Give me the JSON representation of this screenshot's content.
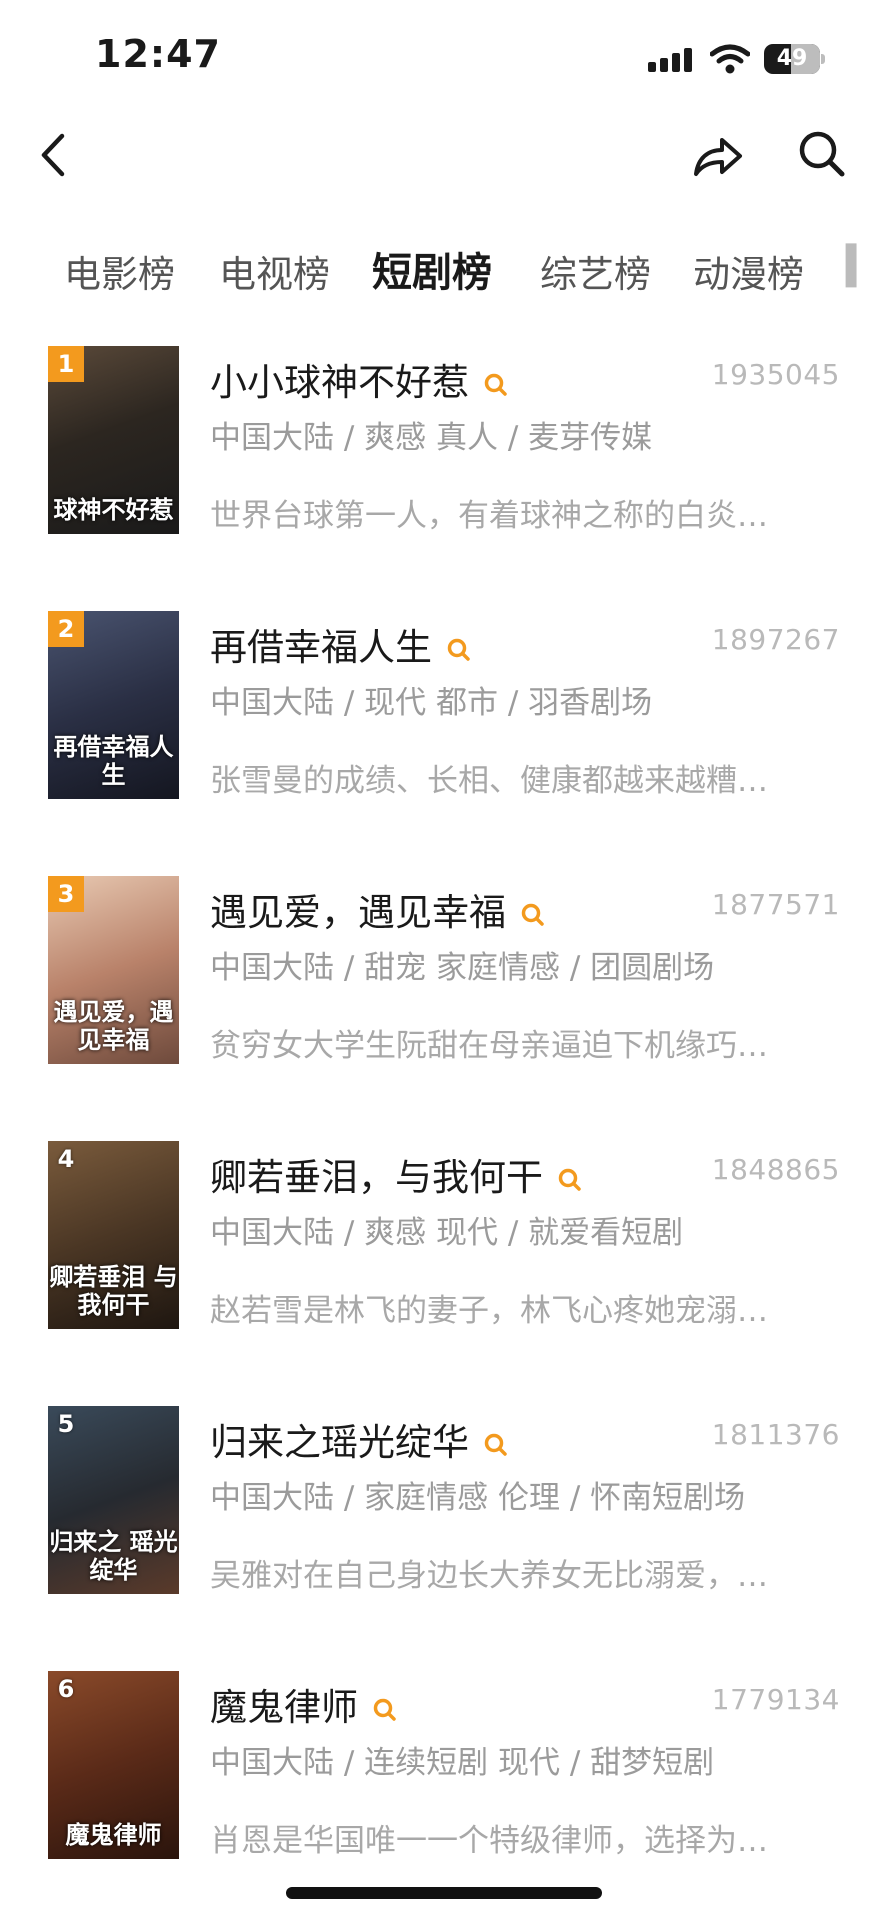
{
  "status": {
    "time": "12:47",
    "battery": "49",
    "battery_level": 0.49
  },
  "nav": {
    "back_icon": "chevron-left-icon",
    "share_icon": "share-arrow-icon",
    "search_icon": "search-icon"
  },
  "tabs": [
    {
      "label": "电影榜",
      "active": false
    },
    {
      "label": "电视榜",
      "active": false
    },
    {
      "label": "短剧榜",
      "active": true
    },
    {
      "label": "综艺榜",
      "active": false
    },
    {
      "label": "动漫榜",
      "active": false
    }
  ],
  "colors": {
    "accent": "#f39a1e",
    "muted": "#9b9b9b"
  },
  "items": [
    {
      "rank": "1",
      "title": "小小球神不好惹",
      "heat": "1935045",
      "meta": "中国大陆 / 爽感 真人 / 麦芽传媒",
      "desc": "世界台球第一人，有着球神之称的白炎…",
      "poster_text": "球神不好惹"
    },
    {
      "rank": "2",
      "title": "再借幸福人生",
      "heat": "1897267",
      "meta": "中国大陆 / 现代 都市 / 羽香剧场",
      "desc": "张雪曼的成绩、长相、健康都越来越糟…",
      "poster_text": "再借幸福人生"
    },
    {
      "rank": "3",
      "title": "遇见爱，遇见幸福",
      "heat": "1877571",
      "meta": "中国大陆 / 甜宠 家庭情感 / 团圆剧场",
      "desc": "贫穷女大学生阮甜在母亲逼迫下机缘巧…",
      "poster_text": "遇见爱，遇见幸福"
    },
    {
      "rank": "4",
      "title": "卿若垂泪，与我何干",
      "heat": "1848865",
      "meta": "中国大陆 / 爽感 现代 / 就爱看短剧",
      "desc": "赵若雪是林飞的妻子，林飞心疼她宠溺…",
      "poster_text": "卿若垂泪 与我何干"
    },
    {
      "rank": "5",
      "title": "归来之瑶光绽华",
      "heat": "1811376",
      "meta": "中国大陆 / 家庭情感 伦理 / 怀南短剧场",
      "desc": "吴雅对在自己身边长大养女无比溺爱，…",
      "poster_text": "归来之 瑶光绽华"
    },
    {
      "rank": "6",
      "title": "魔鬼律师",
      "heat": "1779134",
      "meta": "中国大陆 / 连续短剧 现代 / 甜梦短剧",
      "desc": "肖恩是华国唯一一个特级律师，选择为…",
      "poster_text": "魔鬼律师"
    }
  ]
}
